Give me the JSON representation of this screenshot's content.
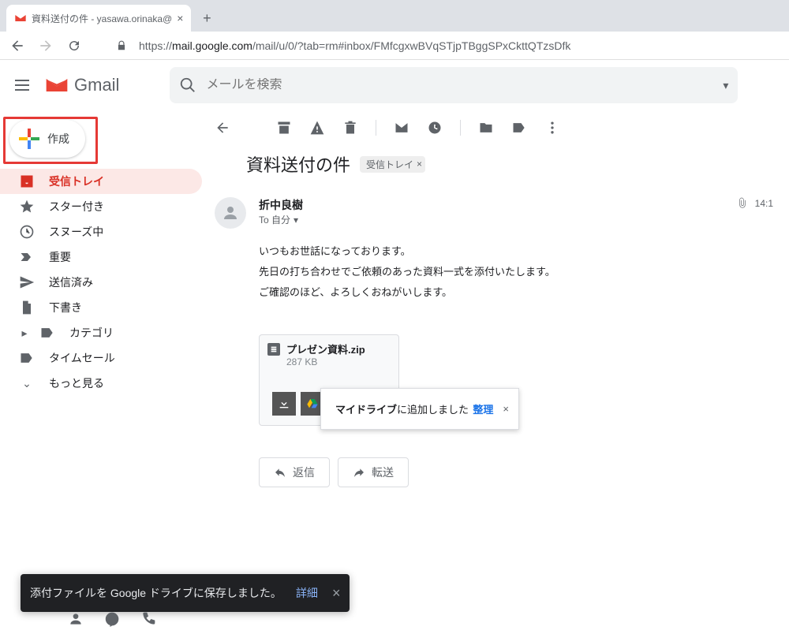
{
  "browser": {
    "tab_title": "資料送付の件 - yasawa.orinaka@",
    "url_display": "https://mail.google.com/mail/u/0/?tab=rm#inbox/FMfcgxwBVqSTjpTBggSPxCkttQTzsDfk",
    "url_host": "mail.google.com"
  },
  "header": {
    "product": "Gmail",
    "search_placeholder": "メールを検索"
  },
  "sidebar": {
    "compose": "作成",
    "items": [
      {
        "label": "受信トレイ"
      },
      {
        "label": "スター付き"
      },
      {
        "label": "スヌーズ中"
      },
      {
        "label": "重要"
      },
      {
        "label": "送信済み"
      },
      {
        "label": "下書き"
      },
      {
        "label": "カテゴリ"
      },
      {
        "label": "タイムセール"
      },
      {
        "label": "もっと見る"
      }
    ]
  },
  "mail": {
    "subject": "資料送付の件",
    "chip": "受信トレイ",
    "sender_name": "折中良樹",
    "to_line": "To 自分",
    "time": "14:1",
    "body_lines": [
      "いつもお世話になっております。",
      "先日の打ち合わせでご依頼のあった資料一式を添付いたします。",
      "ご確認のほど、よろしくおねがいします。"
    ],
    "attachment": {
      "name": "プレゼン資料.zip",
      "size": "287 KB"
    },
    "popup": {
      "bold": "マイドライブ",
      "rest": "に追加しました",
      "action": "整理"
    },
    "reply": "返信",
    "forward": "転送"
  },
  "toast": {
    "message": "添付ファイルを Google ドライブに保存しました。",
    "action": "詳細"
  }
}
